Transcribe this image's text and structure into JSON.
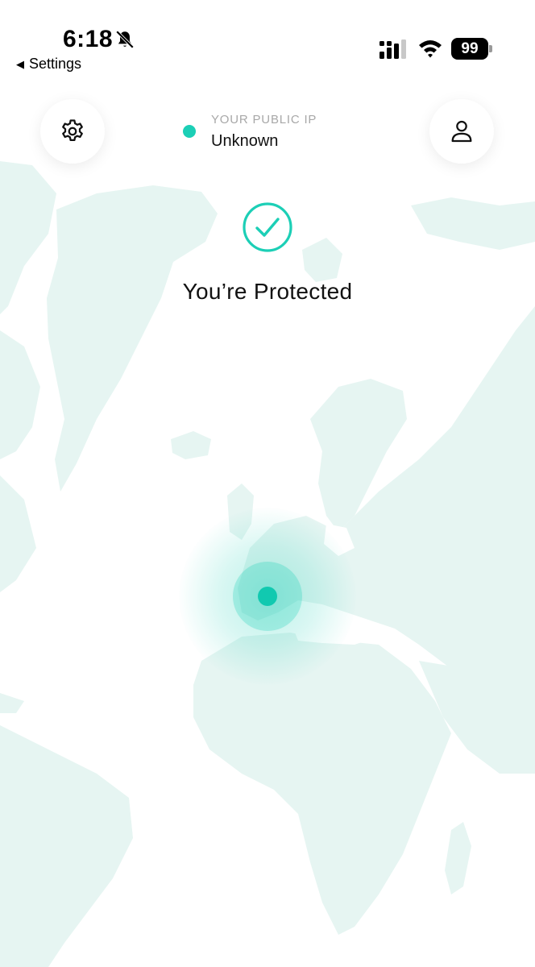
{
  "status_bar": {
    "time": "6:18",
    "back_label": "Settings",
    "back_icon": "back-arrow-icon",
    "battery_level": "99",
    "icons": [
      "bell-slash-icon",
      "cellular-signal-icon",
      "wifi-icon",
      "battery-icon"
    ]
  },
  "header": {
    "settings_icon": "gear-icon",
    "account_icon": "person-icon",
    "ip_label": "YOUR PUBLIC IP",
    "ip_value": "Unknown"
  },
  "connection": {
    "status_icon": "check-circle-icon",
    "status_text": "You’re Protected"
  },
  "map": {
    "location_marker": "location-dot"
  },
  "colors": {
    "accent": "#1ccfb6",
    "map_land": "#e6f5f2",
    "text_primary": "#111111",
    "text_muted": "#a8a8a8"
  }
}
